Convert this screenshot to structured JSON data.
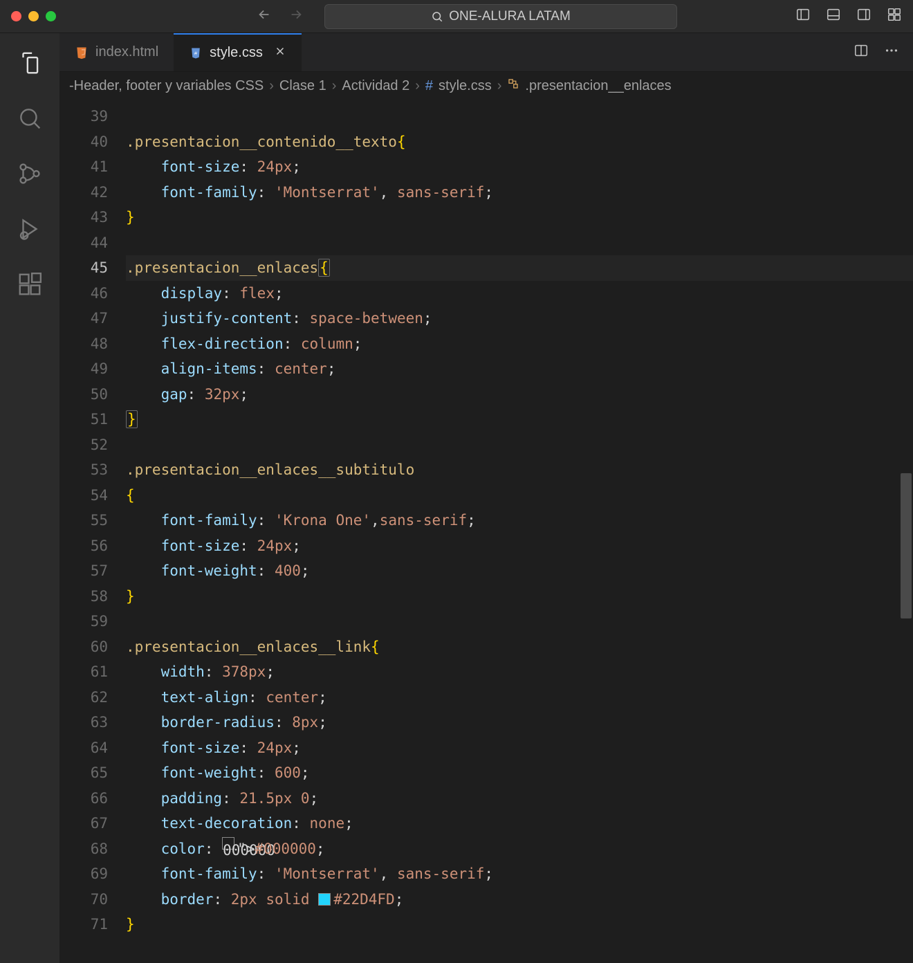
{
  "titlebar": {
    "search_text": "ONE-ALURA LATAM"
  },
  "tabs": [
    {
      "label": "index.html",
      "active": false,
      "modified": false,
      "icon": "html"
    },
    {
      "label": "style.css",
      "active": true,
      "modified": true,
      "icon": "css"
    }
  ],
  "breadcrumb": {
    "parts": [
      "-Header, footer y variables CSS",
      "Clase 1",
      "Actividad 2",
      "style.css",
      ".presentacion__enlaces"
    ]
  },
  "editor": {
    "current_line": 45,
    "lines": [
      {
        "n": 39,
        "text": ""
      },
      {
        "n": 40,
        "text": ".presentacion__contenido__texto{"
      },
      {
        "n": 41,
        "text": "    font-size: 24px;"
      },
      {
        "n": 42,
        "text": "    font-family: 'Montserrat', sans-serif;"
      },
      {
        "n": 43,
        "text": "}"
      },
      {
        "n": 44,
        "text": ""
      },
      {
        "n": 45,
        "text": ".presentacion__enlaces{"
      },
      {
        "n": 46,
        "text": "    display: flex;"
      },
      {
        "n": 47,
        "text": "    justify-content: space-between;"
      },
      {
        "n": 48,
        "text": "    flex-direction: column;"
      },
      {
        "n": 49,
        "text": "    align-items: center;"
      },
      {
        "n": 50,
        "text": "    gap: 32px;"
      },
      {
        "n": 51,
        "text": "}"
      },
      {
        "n": 52,
        "text": ""
      },
      {
        "n": 53,
        "text": ".presentacion__enlaces__subtitulo"
      },
      {
        "n": 54,
        "text": "{"
      },
      {
        "n": 55,
        "text": "    font-family: 'Krona One',sans-serif;"
      },
      {
        "n": 56,
        "text": "    font-size: 24px;"
      },
      {
        "n": 57,
        "text": "    font-weight: 400;"
      },
      {
        "n": 58,
        "text": "}"
      },
      {
        "n": 59,
        "text": ""
      },
      {
        "n": 60,
        "text": ".presentacion__enlaces__link{"
      },
      {
        "n": 61,
        "text": "    width: 378px;"
      },
      {
        "n": 62,
        "text": "    text-align: center;"
      },
      {
        "n": 63,
        "text": "    border-radius: 8px;"
      },
      {
        "n": 64,
        "text": "    font-size: 24px;"
      },
      {
        "n": 65,
        "text": "    font-weight: 600;"
      },
      {
        "n": 66,
        "text": "    padding: 21.5px 0;"
      },
      {
        "n": 67,
        "text": "    text-decoration: none;"
      },
      {
        "n": 68,
        "text": "    color: #000000;"
      },
      {
        "n": 69,
        "text": "    font-family: 'Montserrat', sans-serif;"
      },
      {
        "n": 70,
        "text": "    border: 2px solid #22D4FD;"
      },
      {
        "n": 71,
        "text": "}"
      }
    ]
  },
  "colors": {
    "chip_black": "#000000",
    "chip_cyan": "#22D4FD"
  }
}
